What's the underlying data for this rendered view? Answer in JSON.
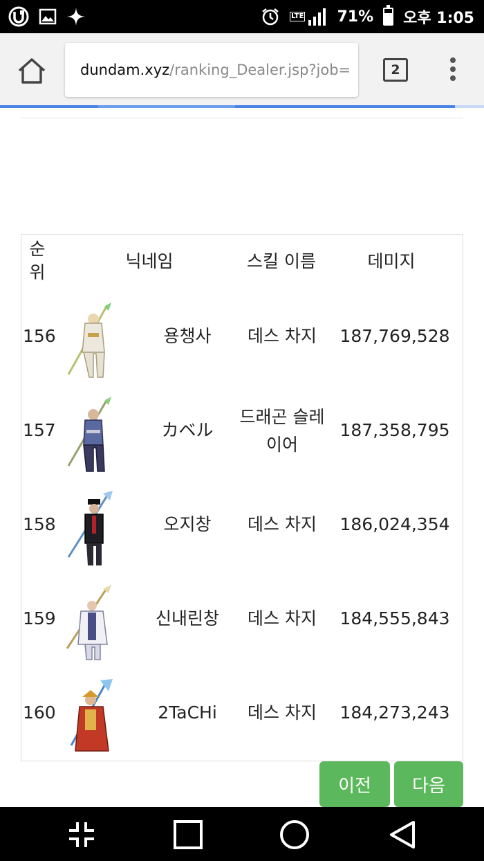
{
  "status_bar": {
    "left_icons": [
      "u-plus-icon",
      "image-icon",
      "sparkle-icon"
    ],
    "network_type": "LTE",
    "battery_percent": "71%",
    "battery_level": 0.71,
    "time": "오후 1:05"
  },
  "browser": {
    "url_domain": "dundam.xyz",
    "url_path": "/ranking_Dealer.jsp?job=",
    "tab_count": "2"
  },
  "table": {
    "headers": {
      "rank": "순위",
      "name": "닉네임",
      "skill": "스킬 이름",
      "damage": "데미지"
    },
    "rows": [
      {
        "rank": "156",
        "name": "용챙사",
        "skill": "데스 차지",
        "damage": "187,769,528",
        "avatar": "character-avatar-white-armor"
      },
      {
        "rank": "157",
        "name": "カベル",
        "skill": "드래곤 슬레이어",
        "damage": "187,358,795",
        "avatar": "character-avatar-dark-armor"
      },
      {
        "rank": "158",
        "name": "오지창",
        "skill": "데스 차지",
        "damage": "186,024,354",
        "avatar": "character-avatar-black-suit"
      },
      {
        "rank": "159",
        "name": "신내린창",
        "skill": "데스 차지",
        "damage": "184,555,843",
        "avatar": "character-avatar-white-coat"
      },
      {
        "rank": "160",
        "name": "2TaCHi",
        "skill": "데스 차지",
        "damage": "184,273,243",
        "avatar": "character-avatar-red-armor"
      }
    ]
  },
  "pagination": {
    "prev_label": "이전",
    "next_label": "다음"
  },
  "colors": {
    "button_green": "#5cb85c",
    "progress_blue": "#4a83e6"
  }
}
